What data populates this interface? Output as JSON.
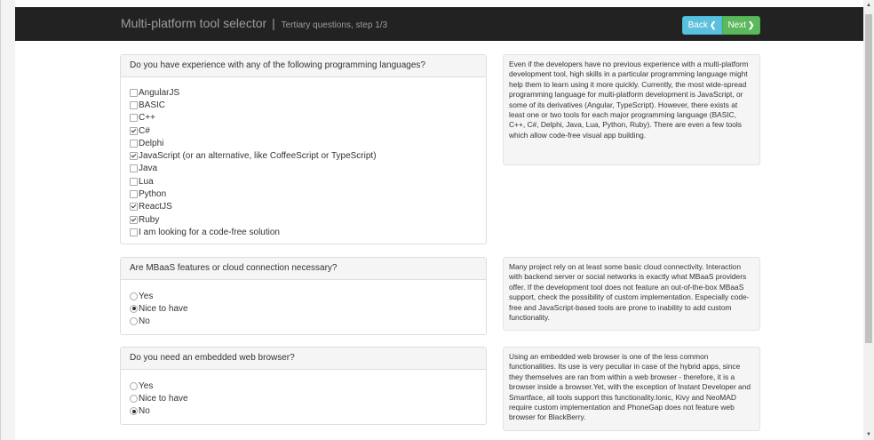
{
  "navbar": {
    "title": "Multi-platform tool selector",
    "separator": "|",
    "subtitle": "Tertiary questions, step 1/3",
    "back_label": "Back",
    "next_label": "Next",
    "back_color": "#5bc0de",
    "next_color": "#5cb85c"
  },
  "questions": [
    {
      "title": "Do you have experience with any of the following programming languages?",
      "type": "checkbox",
      "options": [
        {
          "label": "AngularJS",
          "checked": false
        },
        {
          "label": "BASIC",
          "checked": false
        },
        {
          "label": "C++",
          "checked": false
        },
        {
          "label": "C#",
          "checked": true
        },
        {
          "label": "Delphi",
          "checked": false
        },
        {
          "label": "JavaScript (or an alternative, like CoffeeScript or TypeScript)",
          "checked": true
        },
        {
          "label": "Java",
          "checked": false
        },
        {
          "label": "Lua",
          "checked": false
        },
        {
          "label": "Python",
          "checked": false
        },
        {
          "label": "ReactJS",
          "checked": true
        },
        {
          "label": "Ruby",
          "checked": true
        },
        {
          "label": "I am looking for a code-free solution",
          "checked": false
        }
      ],
      "info": "Even if the developers have no previous experience with a multi-platform development tool, high skills in a particular programming language might help them to learn using it more quickly. Currently, the most wide-spread programming language for multi-platform development is JavaScript, or some of its derivatives (Angular, TypeScript). However, there exists at least one or two tools for each major programming language (BASIC, C++, C#, Delphi, Java, Lua, Python, Ruby). There are even a few tools which allow code-free visual app building."
    },
    {
      "title": "Are MBaaS features or cloud connection necessary?",
      "type": "radio",
      "options": [
        {
          "label": "Yes",
          "checked": false
        },
        {
          "label": "Nice to have",
          "checked": true
        },
        {
          "label": "No",
          "checked": false
        }
      ],
      "info": "Many project rely on at least some basic cloud connectivity. Interaction with backend server or social networks is exactly what MBaaS providers offer. If the development tool does not feature an out-of-the-box MBaaS support, check the possibility of custom implementation. Especially code-free and JavaScript-based tools are prone to inability to add custom functionality."
    },
    {
      "title": "Do you need an embedded web browser?",
      "type": "radio",
      "options": [
        {
          "label": "Yes",
          "checked": false
        },
        {
          "label": "Nice to have",
          "checked": false
        },
        {
          "label": "No",
          "checked": true
        }
      ],
      "info": "Using an embedded web browser is one of the less common functionalities. Its use is very peculiar in case of the hybrid apps, since they themselves are ran from within a web browser - therefore, it is a browser inside a browser.Yet, with the exception of Instant Developer and Smartface, all tools support this functionality.Ionic, Kivy and NeoMAD require custom implementation and PhoneGap does not feature web browser for BlackBerry."
    }
  ]
}
